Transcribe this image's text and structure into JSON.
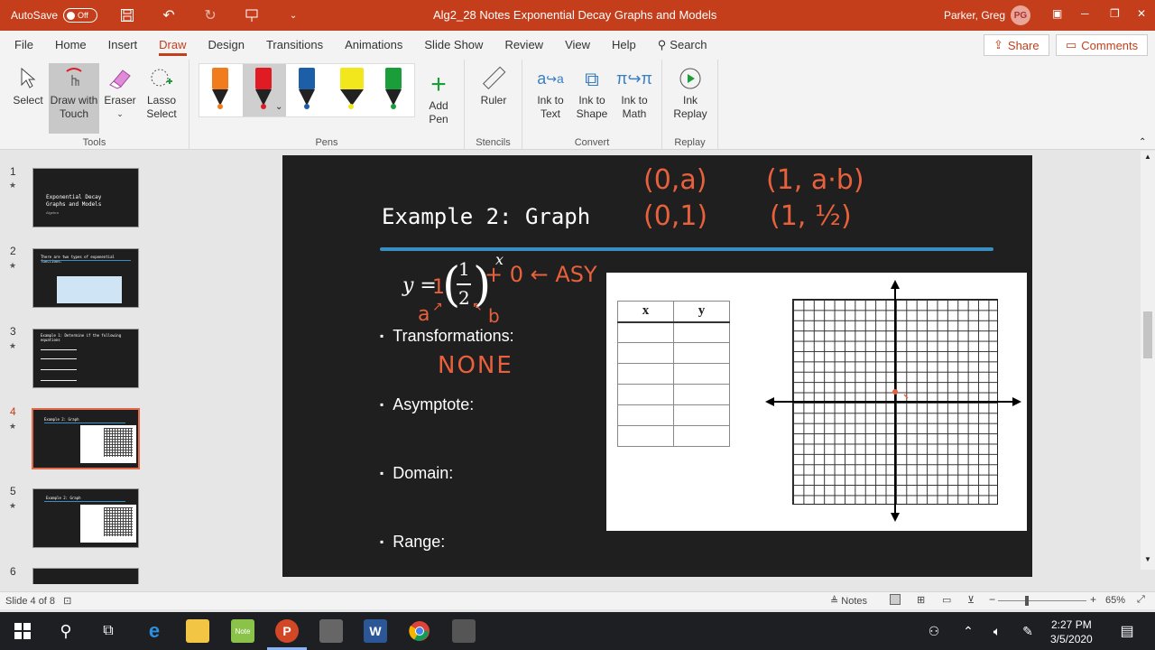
{
  "titlebar": {
    "autosave_label": "AutoSave",
    "autosave_state": "Off",
    "doc_title": "Alg2_28 Notes Exponential Decay Graphs and Models",
    "user_name": "Parker, Greg",
    "user_initials": "PG"
  },
  "tabs": [
    "File",
    "Home",
    "Insert",
    "Draw",
    "Design",
    "Transitions",
    "Animations",
    "Slide Show",
    "Review",
    "View",
    "Help"
  ],
  "search_label": "Search",
  "share_label": "Share",
  "comments_label": "Comments",
  "ribbon": {
    "select": "Select",
    "draw_with_touch": "Draw with Touch",
    "eraser": "Eraser",
    "lasso": "Lasso Select",
    "tools_group": "Tools",
    "add_pen": "Add Pen",
    "pens_group": "Pens",
    "ruler": "Ruler",
    "stencils_group": "Stencils",
    "ink_to_text": "Ink to Text",
    "ink_to_shape": "Ink to Shape",
    "ink_to_math": "Ink to Math",
    "convert_group": "Convert",
    "ink_replay": "Ink Replay",
    "replay_group": "Replay",
    "pen_colors": [
      "#f07c1b",
      "#e01b24",
      "#1c5fa8",
      "#f2e61c",
      "#1a9e3a"
    ]
  },
  "thumbnails": [
    {
      "num": "1",
      "title": "Exponential Decay Graphs and Models",
      "sub": "Algebra"
    },
    {
      "num": "2",
      "title": "There are two types of exponential functions:"
    },
    {
      "num": "3",
      "title": "Example 1: Determine if the following equations"
    },
    {
      "num": "4",
      "title": "Example 2: Graph"
    },
    {
      "num": "5",
      "title": "Example 2: Graph"
    },
    {
      "num": "6",
      "title": ""
    }
  ],
  "slide": {
    "title": "Example 2: Graph",
    "equation_lhs": "y =",
    "fraction_num": "1",
    "fraction_den": "2",
    "exponent": "x",
    "bullets": [
      "Transformations:",
      "Asymptote:",
      "Domain:",
      "Range:"
    ],
    "table_headers": [
      "x",
      "y"
    ],
    "ink": {
      "point_general": "(0,a)",
      "point_general_2": "(1, a·b)",
      "point_specific": "(0,1)",
      "point_specific_2": "(1, ½)",
      "asy_note": "+ 0 ← ASY",
      "label_a": "a",
      "label_b": "b",
      "transform_answer": "NONE",
      "one": "1"
    }
  },
  "status": {
    "slide_info": "Slide 4 of 8",
    "notes_label": "Notes",
    "zoom": "65%"
  },
  "taskbar": {
    "time": "2:27 PM",
    "date": "3/5/2020"
  }
}
